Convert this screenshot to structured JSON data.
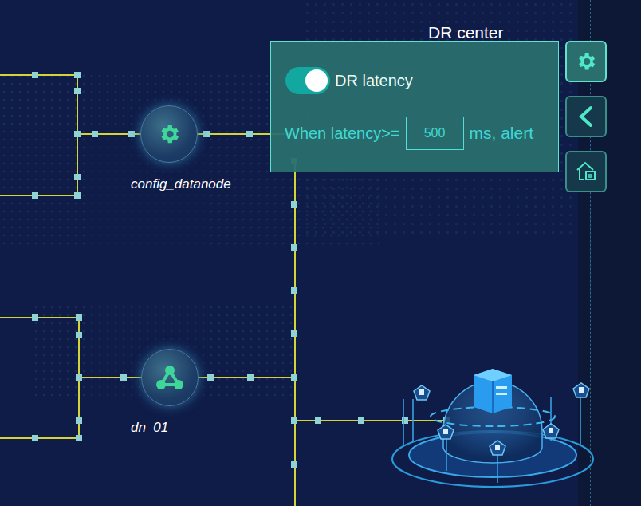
{
  "title": "DR center",
  "nodes": [
    {
      "label": "config_datanode",
      "kind": "config"
    },
    {
      "label": "dn_01",
      "kind": "datanode"
    }
  ],
  "panel": {
    "toggle": {
      "label": "DR latency",
      "on": true
    },
    "prefix": "When latency>=",
    "value": "500",
    "suffix": "ms, alert"
  }
}
